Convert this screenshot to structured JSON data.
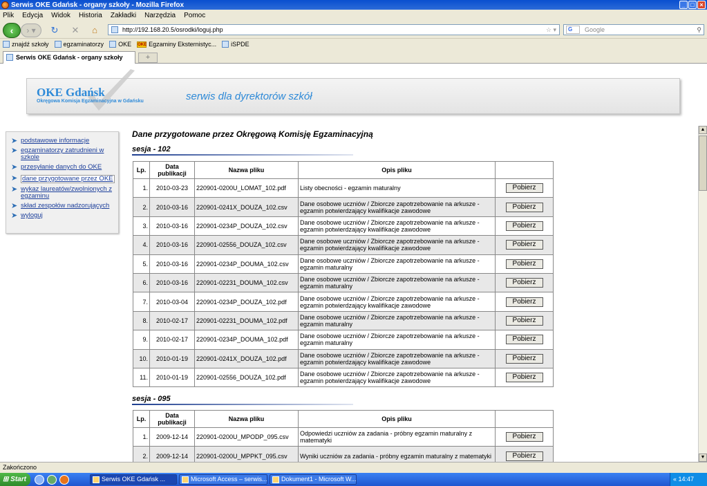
{
  "window": {
    "title": "Serwis OKE Gdańsk - organy szkoły - Mozilla Firefox"
  },
  "menu": [
    "Plik",
    "Edycja",
    "Widok",
    "Historia",
    "Zakładki",
    "Narzędzia",
    "Pomoc"
  ],
  "nav": {
    "url": "http://192.168.20.5/osrodki/loguj.php",
    "search_placeholder": "Google",
    "search_engine": "G"
  },
  "bookmarks": [
    "znajdź szkoły",
    "egzaminatorzy",
    "OKE",
    "Egzaminy Eksternistyc...",
    "iSPDE"
  ],
  "bookmark_oke_icon": "OKE",
  "tab": {
    "label": "Serwis OKE Gdańsk - organy szkoły"
  },
  "banner": {
    "logo_title": "OKE Gdańsk",
    "logo_subtitle": "Okręgowa Komisja Egzaminacyjna w Gdańsku",
    "subtitle": "serwis dla dyrektorów szkół"
  },
  "sidebar": {
    "items": [
      {
        "label": "podstawowe informacje"
      },
      {
        "label": "egzaminatorzy zatrudnieni w szkole"
      },
      {
        "label": "przesyłanie danych do OKE"
      },
      {
        "label": "dane przygotowane przez OKE"
      },
      {
        "label": "wykaz laureatów/zwolnionych z egzaminu"
      },
      {
        "label": "skład zespołów nadzorujących"
      },
      {
        "label": "wyloguj"
      }
    ]
  },
  "main": {
    "title": "Dane przygotowane przez Okręgową Komisję Egzaminacyjną",
    "headers": {
      "lp": "Lp.",
      "date": "Data publikacji",
      "name": "Nazwa pliku",
      "desc": "Opis pliku"
    },
    "button_label": "Pobierz",
    "sessions": [
      {
        "label": "sesja - 102",
        "rows": [
          {
            "lp": "1.",
            "date": "2010-03-23",
            "file": "220901-0200U_LOMAT_102.pdf",
            "desc": "Listy obecności - egzamin maturalny"
          },
          {
            "lp": "2.",
            "date": "2010-03-16",
            "file": "220901-0241X_DOUZA_102.csv",
            "desc": "Dane osobowe uczniów / Zbiorcze zapotrzebowanie na arkusze - egzamin potwierdzający kwalifikacje zawodowe"
          },
          {
            "lp": "3.",
            "date": "2010-03-16",
            "file": "220901-0234P_DOUZA_102.csv",
            "desc": "Dane osobowe uczniów / Zbiorcze zapotrzebowanie na arkusze - egzamin potwierdzający kwalifikacje zawodowe"
          },
          {
            "lp": "4.",
            "date": "2010-03-16",
            "file": "220901-02556_DOUZA_102.csv",
            "desc": "Dane osobowe uczniów / Zbiorcze zapotrzebowanie na arkusze - egzamin potwierdzający kwalifikacje zawodowe"
          },
          {
            "lp": "5.",
            "date": "2010-03-16",
            "file": "220901-0234P_DOUMA_102.csv",
            "desc": "Dane osobowe uczniów / Zbiorcze zapotrzebowanie na arkusze - egzamin maturalny"
          },
          {
            "lp": "6.",
            "date": "2010-03-16",
            "file": "220901-02231_DOUMA_102.csv",
            "desc": "Dane osobowe uczniów / Zbiorcze zapotrzebowanie na arkusze - egzamin maturalny"
          },
          {
            "lp": "7.",
            "date": "2010-03-04",
            "file": "220901-0234P_DOUZA_102.pdf",
            "desc": "Dane osobowe uczniów / Zbiorcze zapotrzebowanie na arkusze - egzamin potwierdzający kwalifikacje zawodowe"
          },
          {
            "lp": "8.",
            "date": "2010-02-17",
            "file": "220901-02231_DOUMA_102.pdf",
            "desc": "Dane osobowe uczniów / Zbiorcze zapotrzebowanie na arkusze - egzamin maturalny"
          },
          {
            "lp": "9.",
            "date": "2010-02-17",
            "file": "220901-0234P_DOUMA_102.pdf",
            "desc": "Dane osobowe uczniów / Zbiorcze zapotrzebowanie na arkusze - egzamin maturalny"
          },
          {
            "lp": "10.",
            "date": "2010-01-19",
            "file": "220901-0241X_DOUZA_102.pdf",
            "desc": "Dane osobowe uczniów / Zbiorcze zapotrzebowanie na arkusze - egzamin potwierdzający kwalifikacje zawodowe"
          },
          {
            "lp": "11.",
            "date": "2010-01-19",
            "file": "220901-02556_DOUZA_102.pdf",
            "desc": "Dane osobowe uczniów / Zbiorcze zapotrzebowanie na arkusze - egzamin potwierdzający kwalifikacje zawodowe"
          }
        ]
      },
      {
        "label": "sesja - 095",
        "rows": [
          {
            "lp": "1.",
            "date": "2009-12-14",
            "file": "220901-0200U_MPODP_095.csv",
            "desc": "Odpowiedzi uczniów za zadania - próbny egzamin maturalny z matematyki"
          },
          {
            "lp": "2.",
            "date": "2009-12-14",
            "file": "220901-0200U_MPPKT_095.csv",
            "desc": "Wyniki uczniów za zadania - próbny egzamin maturalny z matematyki"
          }
        ]
      }
    ]
  },
  "status": {
    "text": "Zakończono"
  },
  "taskbar": {
    "start": "Start",
    "tasks": [
      "Serwis OKE Gdańsk ...",
      "Microsoft Access – serwis...",
      "Dokument1 - Microsoft W..."
    ],
    "clock": "14:47"
  },
  "colors": {
    "accent": "#2e8ad8",
    "link": "#1a3d9a",
    "titlebar": "#0a4fcf"
  }
}
